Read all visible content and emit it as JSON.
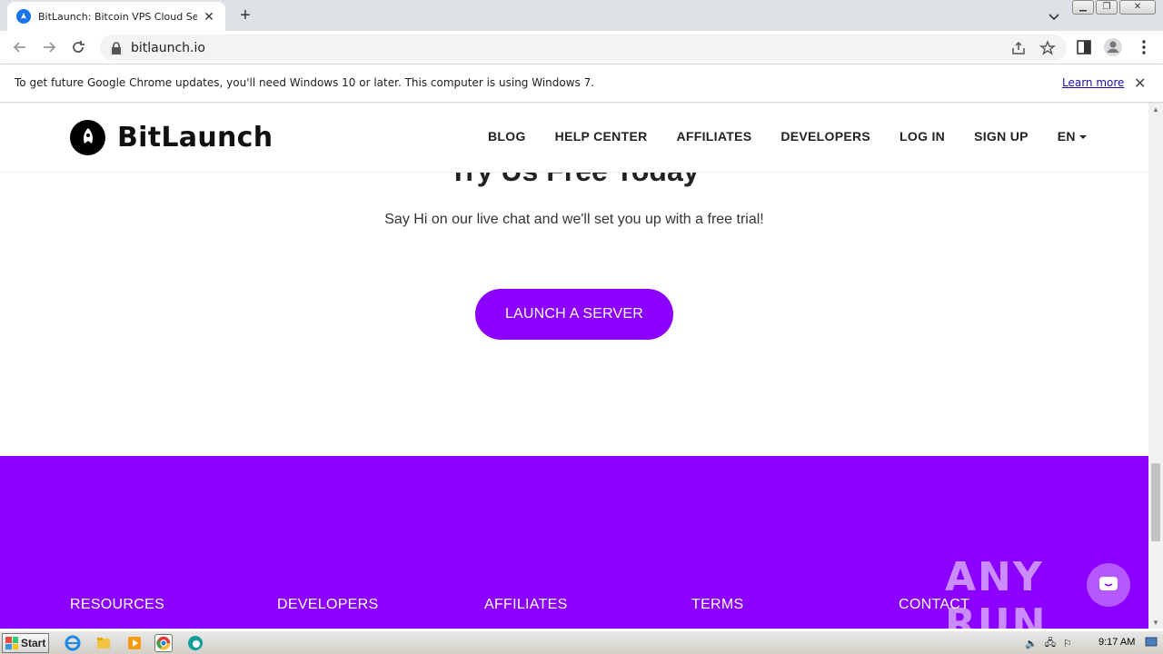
{
  "browser": {
    "tab_title": "BitLaunch: Bitcoin VPS Cloud Servers",
    "url": "bitlaunch.io"
  },
  "infobar": {
    "message": "To get future Google Chrome updates, you'll need Windows 10 or later. This computer is using Windows 7.",
    "link": "Learn more"
  },
  "site": {
    "logo_text": "BitLaunch",
    "nav": [
      "BLOG",
      "HELP CENTER",
      "AFFILIATES",
      "DEVELOPERS",
      "LOG IN",
      "SIGN UP",
      "EN"
    ]
  },
  "hero": {
    "title": "Try Us Free Today",
    "subtitle": "Say Hi on our live chat and we'll set you up with a free trial!",
    "cta": "LAUNCH A SERVER"
  },
  "footer": {
    "columns": [
      "RESOURCES",
      "DEVELOPERS",
      "AFFILIATES",
      "TERMS",
      "CONTACT"
    ]
  },
  "watermark": "ANY RUN",
  "taskbar": {
    "start_label": "Start",
    "clock": "9:17 AM"
  },
  "colors": {
    "brand_purple": "#8c00ff",
    "chrome_frame": "#dee1e6"
  }
}
